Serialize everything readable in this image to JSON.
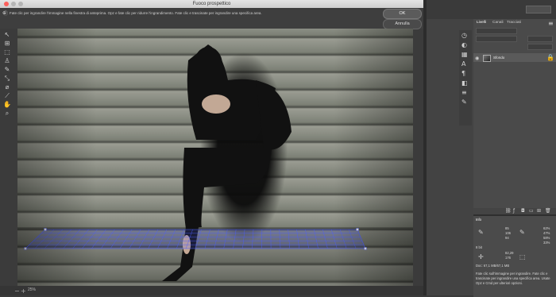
{
  "dialog": {
    "title": "Fuoco prospettico",
    "hint": "Fate clic per ingrandire l'immagine nella finestra di anteprima. Opz e fate clic per ridurre l'ingrandimento. Fate clic e trascinate per ingrandire una specifica area.",
    "ok_label": "OK",
    "cancel_label": "Annulla",
    "zoom": "25%"
  },
  "panels": {
    "tabs": [
      "Livelli",
      "Canali",
      "Tracciati"
    ],
    "layer_name": "Sfondo",
    "info_tab": "Info",
    "info_values": {
      "r": "85",
      "g": "106",
      "b": "94",
      "c": "62%",
      "m": "47%",
      "y": "58%",
      "k": "33%",
      "bits": "8 bit",
      "x": "82,29",
      "y_coord": "176",
      "doc": "Doc: 67,1 MB/67,1 MB",
      "help": "Fate clic sull'immagine per ingrandire. Fate clic e trascinate per ingrandire una specifica area. Usate Opz e Cmd per ulteriori opzioni."
    }
  },
  "icons": [
    "edit-plane-icon",
    "create-plane-icon",
    "marquee-icon",
    "stamp-icon",
    "brush-icon",
    "transform-icon",
    "eyedropper-icon",
    "measure-icon",
    "hand-icon",
    "zoom-icon"
  ],
  "colors": {
    "grid": "#4b5cff"
  }
}
